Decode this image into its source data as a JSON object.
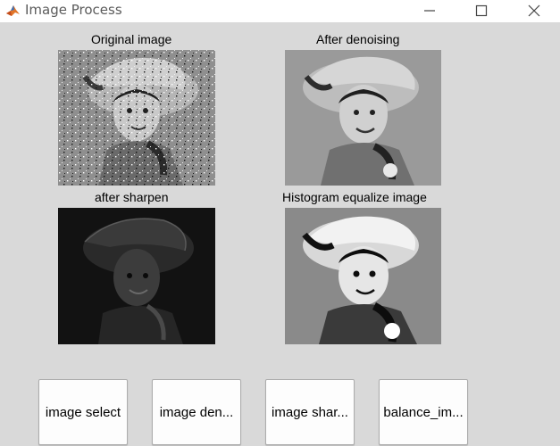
{
  "window": {
    "title": "Image Process",
    "icon": "matlab-icon",
    "controls": [
      "minimize-icon",
      "maximize-icon",
      "close-icon"
    ]
  },
  "panels": {
    "original": {
      "title": "Original image"
    },
    "denoised": {
      "title": "After denoising"
    },
    "sharpened": {
      "title": "after sharpen"
    },
    "equalized": {
      "title": "Histogram equalize image"
    }
  },
  "buttons": {
    "select": "image select",
    "denoise": "image den...",
    "sharpen": "image shar...",
    "balance": "balance_im..."
  },
  "colors": {
    "background": "#d9d9d9",
    "titlebar": "#ffffff",
    "button_face": "#fdfdfd"
  }
}
